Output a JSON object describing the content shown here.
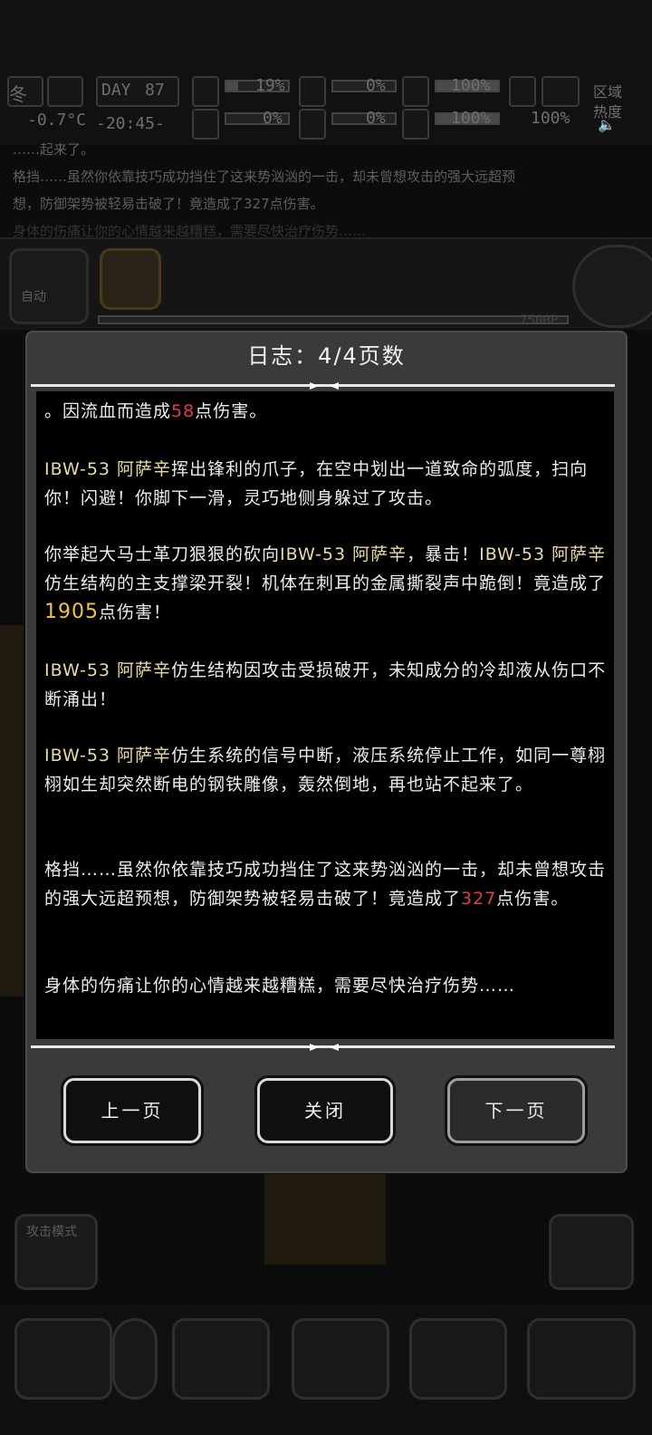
{
  "hud": {
    "season_label": "冬",
    "temperature": "-0.7°C",
    "day_label": "DAY",
    "day_number": "87",
    "clock": "-20:45-",
    "stat_1": "19%",
    "stat_2": "0%",
    "stat_3": "0%",
    "stat_4": "0%",
    "stat_5": "100%",
    "stat_6": "100%",
    "stat_7": "100%",
    "area_label": "区域",
    "heat_label": "热度"
  },
  "background": {
    "log_lines": [
      "……起来了。",
      "格挡……虽然你依靠技巧成功挡住了这来势汹汹的一击，却未曾想攻击的强大远超预",
      "想，防御架势被轻易击破了！竟造成了327点伤害。",
      "身体的伤痛让你的心情越来越糟糕，需要尽快治疗伤势……"
    ],
    "auto_label": "自动",
    "money": "7500P",
    "attack_mode_label": "攻击模式"
  },
  "dialog": {
    "title": "日志：4/4页数",
    "entries": {
      "e1": {
        "prefix": "。因流血而造成",
        "dmg": "58",
        "suffix": "点伤害。"
      },
      "e2": {
        "name": "IBW-53 阿萨辛",
        "text": "挥出锋利的爪子，在空中划出一道致命的弧度，扫向你！闪避！你脚下一滑，灵巧地侧身躲过了攻击。"
      },
      "e3": {
        "pre": "你举起大马士革刀狠狠的砍向",
        "name": "IBW-53 阿萨辛",
        "mid": "，暴击！",
        "name2": "IBW-53 阿萨辛",
        "text": "仿生结构的主支撑梁开裂！机体在刺耳的金属撕裂声中跪倒！竟造成了",
        "dmg": "1905",
        "suffix": "点伤害！"
      },
      "e4": {
        "name": "IBW-53 阿萨辛",
        "text": "仿生结构因攻击受损破开，未知成分的冷却液从伤口不断涌出！"
      },
      "e5": {
        "name": "IBW-53 阿萨辛",
        "text": "仿生系统的信号中断，液压系统停止工作，如同一尊栩栩如生却突然断电的钢铁雕像，轰然倒地，再也站不起来了。"
      },
      "e6": {
        "text": "格挡……虽然你依靠技巧成功挡住了这来势汹汹的一击，却未曾想攻击的强大远超预想，防御架势被轻易击破了！竟造成了",
        "dmg": "327",
        "suffix": "点伤害。"
      },
      "e7": {
        "text": "身体的伤痛让你的心情越来越糟糕，需要尽快治疗伤势……"
      }
    },
    "buttons": {
      "prev": "上一页",
      "close": "关闭",
      "next": "下一页"
    }
  },
  "colors": {
    "entity": "#e8dca2",
    "damage_red": "#e13f3f",
    "damage_gold": "#f0c24a",
    "panel": "#3a3a3a"
  }
}
